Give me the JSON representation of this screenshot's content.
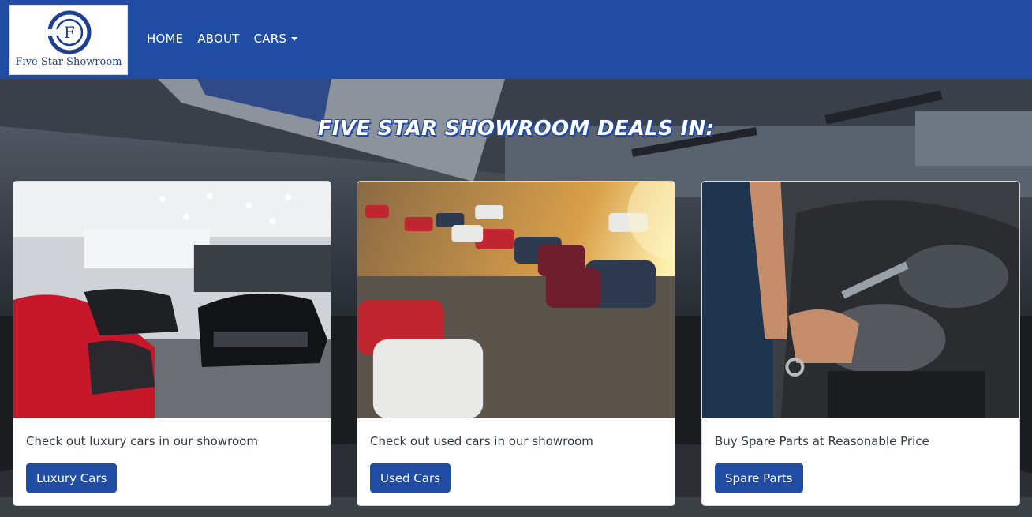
{
  "brand": {
    "name": "Five Star Showroom",
    "logo_letters": "F"
  },
  "nav": {
    "items": [
      {
        "label": "HOME"
      },
      {
        "label": "ABOUT"
      },
      {
        "label": "CARS"
      }
    ]
  },
  "hero": {
    "headline": "FIVE STAR SHOWROOM DEALS IN:"
  },
  "cards": [
    {
      "text": "Check out luxury cars in our showroom",
      "button": "Luxury Cars",
      "image": "luxury-showroom-image"
    },
    {
      "text": "Check out used cars in our showroom",
      "button": "Used Cars",
      "image": "used-cars-lot-image"
    },
    {
      "text": "Buy Spare Parts at Reasonable Price",
      "button": "Spare Parts",
      "image": "engine-mechanic-image"
    }
  ],
  "colors": {
    "primary": "#204ca3",
    "card_bg": "#ffffff"
  }
}
